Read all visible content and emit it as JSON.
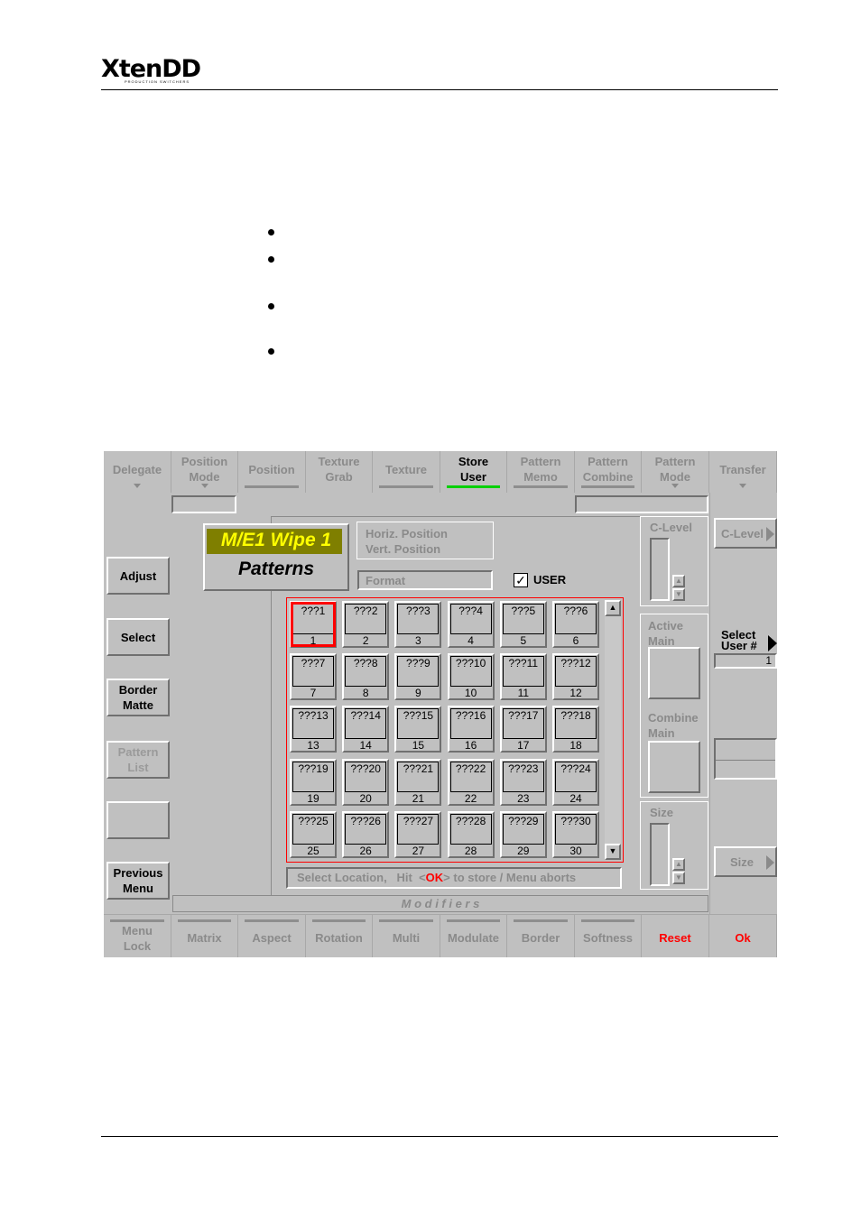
{
  "logo": {
    "main": "XtenDD",
    "sub": "PRODUCTION SWITCHERS"
  },
  "top_tabs": [
    {
      "label": "Delegate",
      "arrow": true,
      "underline": false
    },
    {
      "label": "Position\nMode",
      "arrow": true,
      "underline": false
    },
    {
      "label": "Position",
      "arrow": false,
      "underline": true
    },
    {
      "label": "Texture\nGrab",
      "arrow": false,
      "underline": false
    },
    {
      "label": "Texture",
      "arrow": false,
      "underline": true
    },
    {
      "label": "Store\nUser",
      "arrow": false,
      "underline": true,
      "active": true
    },
    {
      "label": "Pattern\nMemo",
      "arrow": false,
      "underline": true
    },
    {
      "label": "Pattern\nCombine",
      "arrow": false,
      "underline": true
    },
    {
      "label": "Pattern\nMode",
      "arrow": true,
      "underline": false
    },
    {
      "label": "Transfer",
      "arrow": true,
      "underline": false
    }
  ],
  "left_buttons": [
    {
      "label": "Adjust",
      "enabled": true
    },
    {
      "label": "Select",
      "enabled": true
    },
    {
      "label": "Border\nMatte",
      "enabled": true
    },
    {
      "label": "Pattern\nList",
      "enabled": false
    },
    {
      "label": "",
      "enabled": true
    },
    {
      "label": "Previous\nMenu",
      "enabled": true
    }
  ],
  "title": {
    "line1": "M/E1 Wipe 1",
    "line2": "Patterns"
  },
  "position_labels": {
    "horiz": "Horiz. Position",
    "vert": "Vert.  Position"
  },
  "format_label": "Format",
  "user_checkbox": {
    "label": "USER",
    "checked": true,
    "check_mark": "✓"
  },
  "grid": {
    "selected": 1,
    "cells": [
      {
        "name": "???1",
        "num": "1"
      },
      {
        "name": "???2",
        "num": "2"
      },
      {
        "name": "???3",
        "num": "3"
      },
      {
        "name": "???4",
        "num": "4"
      },
      {
        "name": "???5",
        "num": "5"
      },
      {
        "name": "???6",
        "num": "6"
      },
      {
        "name": "???7",
        "num": "7"
      },
      {
        "name": "???8",
        "num": "8"
      },
      {
        "name": "???9",
        "num": "9"
      },
      {
        "name": "???10",
        "num": "10"
      },
      {
        "name": "???11",
        "num": "11"
      },
      {
        "name": "???12",
        "num": "12"
      },
      {
        "name": "???13",
        "num": "13"
      },
      {
        "name": "???14",
        "num": "14"
      },
      {
        "name": "???15",
        "num": "15"
      },
      {
        "name": "???16",
        "num": "16"
      },
      {
        "name": "???17",
        "num": "17"
      },
      {
        "name": "???18",
        "num": "18"
      },
      {
        "name": "???19",
        "num": "19"
      },
      {
        "name": "???20",
        "num": "20"
      },
      {
        "name": "???21",
        "num": "21"
      },
      {
        "name": "???22",
        "num": "22"
      },
      {
        "name": "???23",
        "num": "23"
      },
      {
        "name": "???24",
        "num": "24"
      },
      {
        "name": "???25",
        "num": "25"
      },
      {
        "name": "???26",
        "num": "26"
      },
      {
        "name": "???27",
        "num": "27"
      },
      {
        "name": "???28",
        "num": "28"
      },
      {
        "name": "???29",
        "num": "29"
      },
      {
        "name": "???30",
        "num": "30"
      }
    ]
  },
  "status": {
    "prefix": "Select Location,   Hit  <",
    "ok": "OK",
    "suffix": "> to store / Menu aborts"
  },
  "modifiers_label": "M o d i f i e r s",
  "clevel": {
    "label": "C-Level",
    "button": "C-Level"
  },
  "active_main_label": "Active\nMain",
  "combine_main_label": "Combine\nMain",
  "size": {
    "label": "Size",
    "button": "Size"
  },
  "select_user": {
    "label": "Select\nUser #",
    "value": "1"
  },
  "bottom_buttons": [
    {
      "label": "Menu\nLock",
      "red": false,
      "underline": true
    },
    {
      "label": "Matrix",
      "red": false,
      "underline": true
    },
    {
      "label": "Aspect",
      "red": false,
      "underline": true
    },
    {
      "label": "Rotation",
      "red": false,
      "underline": true
    },
    {
      "label": "Multi",
      "red": false,
      "underline": true
    },
    {
      "label": "Modulate",
      "red": false,
      "underline": true
    },
    {
      "label": "Border",
      "red": false,
      "underline": true
    },
    {
      "label": "Softness",
      "red": false,
      "underline": true
    },
    {
      "label": "Reset",
      "red": true,
      "underline": false
    },
    {
      "label": "Ok",
      "red": true,
      "underline": false
    }
  ],
  "colors": {
    "panel_bg": "#c0c0c0",
    "title_bg": "#7f7f00",
    "title_fg": "#ffff00",
    "accent_red": "#ff0000",
    "active_green": "#00d000"
  }
}
